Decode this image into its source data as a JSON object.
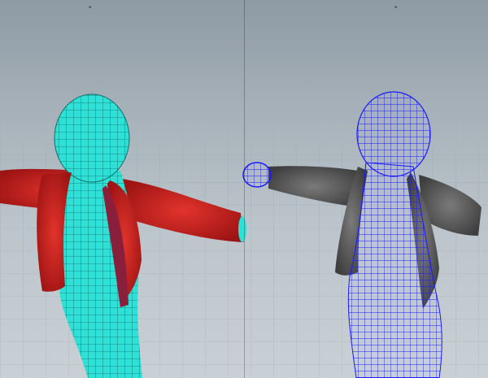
{
  "scene": {
    "left_viewport": {
      "body_mesh_color": "#2ee0d6",
      "jacket_color": "#c8201e",
      "jacket_inner_color": "#8a1f3c"
    },
    "right_viewport": {
      "wireframe_color": "#1a1aff",
      "jacket_color": "#5c5c5c"
    },
    "top_marks": [
      "•",
      "•"
    ]
  }
}
